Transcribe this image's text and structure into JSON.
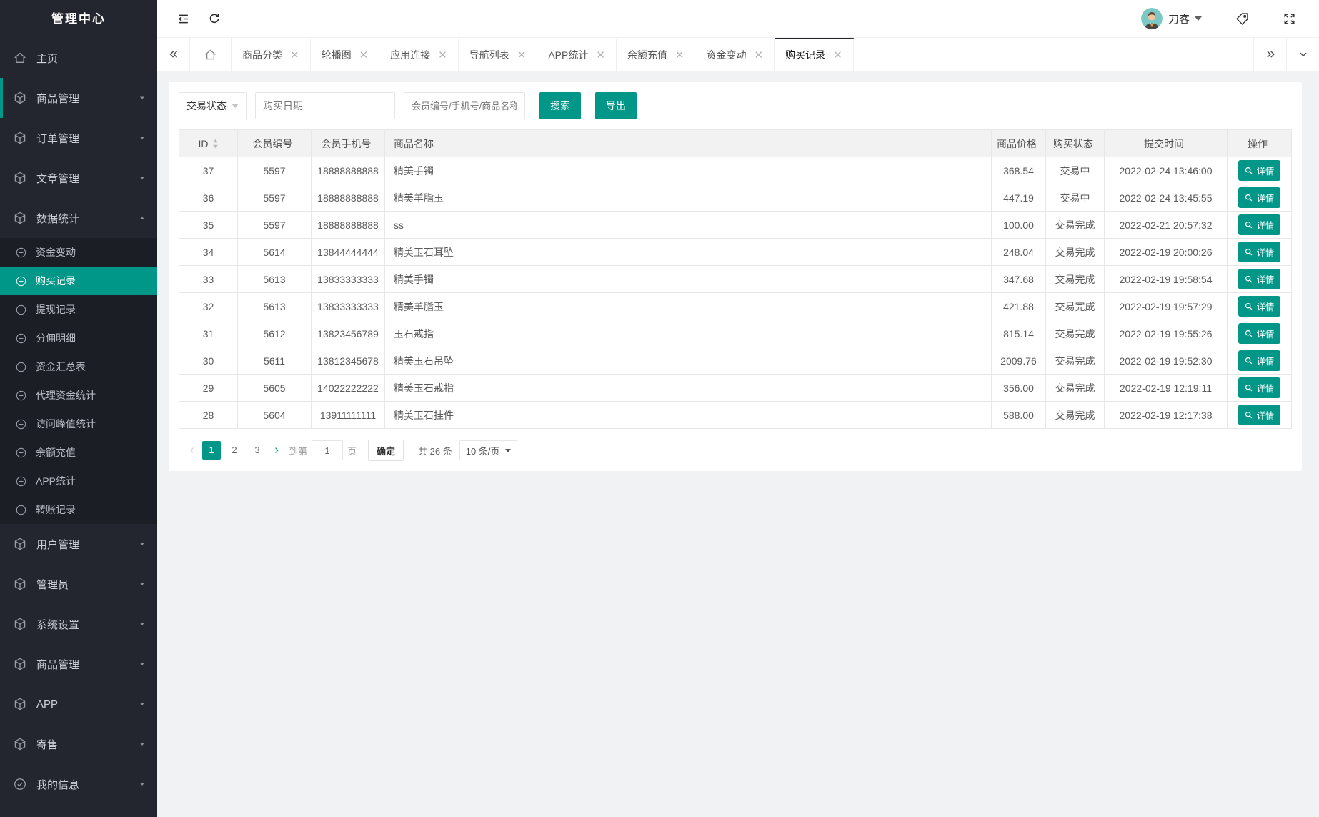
{
  "colors": {
    "accent": "#009688",
    "sidebar_bg": "#23262e",
    "submenu_bg": "#1b1e25",
    "active_tab_border": "#23262e"
  },
  "sidebar": {
    "title": "管理中心",
    "menu": [
      {
        "label": "主页",
        "icon": "home"
      },
      {
        "label": "商品管理",
        "icon": "cube",
        "caret": "down",
        "accent": true
      },
      {
        "label": "订单管理",
        "icon": "cube",
        "caret": "down"
      },
      {
        "label": "文章管理",
        "icon": "cube",
        "caret": "down"
      },
      {
        "label": "数据统计",
        "icon": "cube",
        "caret": "up"
      }
    ],
    "submenu": [
      {
        "label": "资金变动"
      },
      {
        "label": "购买记录",
        "active": true
      },
      {
        "label": "提现记录"
      },
      {
        "label": "分佣明细"
      },
      {
        "label": "资金汇总表"
      },
      {
        "label": "代理资金统计"
      },
      {
        "label": "访问峰值统计"
      },
      {
        "label": "余额充值"
      },
      {
        "label": "APP统计"
      },
      {
        "label": "转账记录"
      }
    ],
    "menu_bottom": [
      {
        "label": "用户管理",
        "icon": "cube",
        "caret": "down"
      },
      {
        "label": "管理员",
        "icon": "cube",
        "caret": "down"
      },
      {
        "label": "系统设置",
        "icon": "cube",
        "caret": "down"
      },
      {
        "label": "商品管理",
        "icon": "cube",
        "caret": "down"
      },
      {
        "label": "APP",
        "icon": "cube",
        "caret": "down"
      },
      {
        "label": "寄售",
        "icon": "cube",
        "caret": "down"
      },
      {
        "label": "我的信息",
        "icon": "check",
        "caret": "down"
      }
    ]
  },
  "topbar": {
    "user_name": "刀客"
  },
  "tabs": {
    "items": [
      {
        "label": "商品分类"
      },
      {
        "label": "轮播图"
      },
      {
        "label": "应用连接"
      },
      {
        "label": "导航列表"
      },
      {
        "label": "APP统计"
      },
      {
        "label": "余额充值"
      },
      {
        "label": "资金变动"
      },
      {
        "label": "购买记录",
        "active": true
      }
    ]
  },
  "filters": {
    "status_select": "交易状态",
    "date_placeholder": "购买日期",
    "keyword_placeholder": "会员编号/手机号/商品名称",
    "search_label": "搜索",
    "export_label": "导出"
  },
  "table": {
    "columns": [
      "ID",
      "会员编号",
      "会员手机号",
      "商品名称",
      "商品价格",
      "购买状态",
      "提交时间",
      "操作"
    ],
    "sort_column": "ID",
    "detail_label": "详情",
    "rows": [
      {
        "id": "37",
        "member_no": "5597",
        "phone": "18888888888",
        "product": "精美手镯",
        "price": "368.54",
        "status": "交易中",
        "time": "2022-02-24 13:46:00"
      },
      {
        "id": "36",
        "member_no": "5597",
        "phone": "18888888888",
        "product": "精美羊脂玉",
        "price": "447.19",
        "status": "交易中",
        "time": "2022-02-24 13:45:55"
      },
      {
        "id": "35",
        "member_no": "5597",
        "phone": "18888888888",
        "product": "ss",
        "price": "100.00",
        "status": "交易完成",
        "time": "2022-02-21 20:57:32"
      },
      {
        "id": "34",
        "member_no": "5614",
        "phone": "13844444444",
        "product": "精美玉石耳坠",
        "price": "248.04",
        "status": "交易完成",
        "time": "2022-02-19 20:00:26"
      },
      {
        "id": "33",
        "member_no": "5613",
        "phone": "13833333333",
        "product": "精美手镯",
        "price": "347.68",
        "status": "交易完成",
        "time": "2022-02-19 19:58:54"
      },
      {
        "id": "32",
        "member_no": "5613",
        "phone": "13833333333",
        "product": "精美羊脂玉",
        "price": "421.88",
        "status": "交易完成",
        "time": "2022-02-19 19:57:29"
      },
      {
        "id": "31",
        "member_no": "5612",
        "phone": "13823456789",
        "product": "玉石戒指",
        "price": "815.14",
        "status": "交易完成",
        "time": "2022-02-19 19:55:26"
      },
      {
        "id": "30",
        "member_no": "5611",
        "phone": "13812345678",
        "product": "精美玉石吊坠",
        "price": "2009.76",
        "status": "交易完成",
        "time": "2022-02-19 19:52:30"
      },
      {
        "id": "29",
        "member_no": "5605",
        "phone": "14022222222",
        "product": "精美玉石戒指",
        "price": "356.00",
        "status": "交易完成",
        "time": "2022-02-19 12:19:11"
      },
      {
        "id": "28",
        "member_no": "5604",
        "phone": "13911111111",
        "product": "精美玉石挂件",
        "price": "588.00",
        "status": "交易完成",
        "time": "2022-02-19 12:17:38"
      }
    ]
  },
  "pagination": {
    "pages": [
      "1",
      "2",
      "3"
    ],
    "active_page": "1",
    "goto_label": "到第",
    "goto_value": "1",
    "page_unit": "页",
    "confirm_label": "确定",
    "total_label": "共 26 条",
    "page_size": "10 条/页"
  },
  "icons": {
    "sidebar": [
      "home-icon",
      "cube-icon",
      "plus-circle-icon",
      "check-circle-icon",
      "caret-down-icon",
      "caret-up-icon"
    ],
    "topbar": [
      "collapse-sidebar-icon",
      "refresh-icon",
      "avatar",
      "user-caret-icon",
      "tag-icon",
      "fullscreen-icon"
    ],
    "tabbar": [
      "double-chevron-left-icon",
      "home-icon",
      "close-icon",
      "double-chevron-right-icon",
      "chevron-down-icon"
    ],
    "table": [
      "sort-icon",
      "magnifier-icon",
      "chevron-left-icon",
      "chevron-right-icon",
      "dropdown-caret-icon"
    ]
  }
}
